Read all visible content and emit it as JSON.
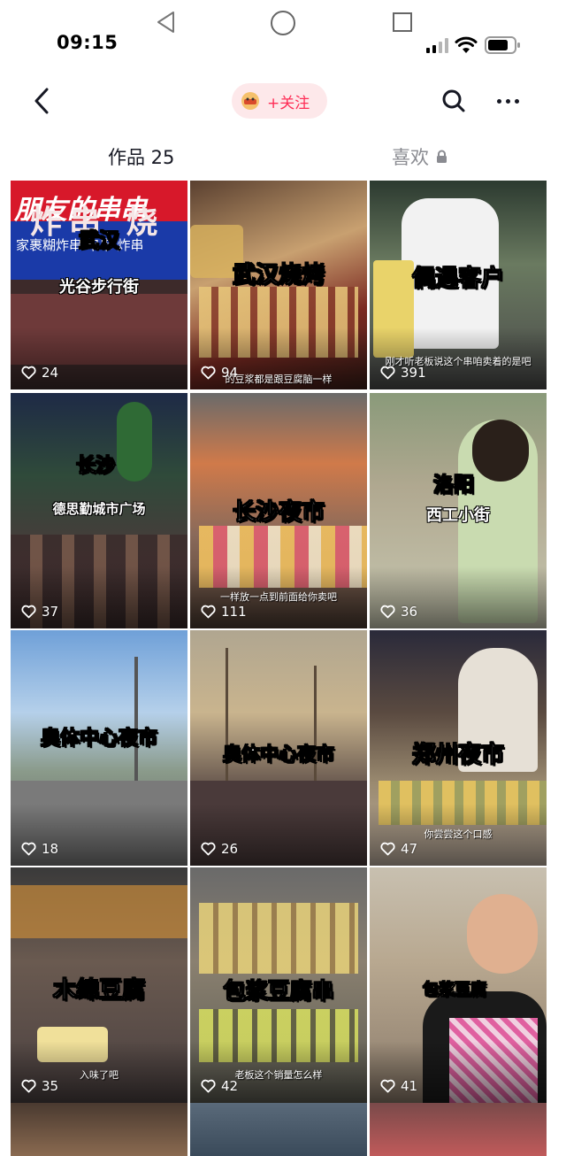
{
  "status": {
    "time": "09:15"
  },
  "nav": {
    "follow_label": "+关注"
  },
  "tabs": {
    "works": "作品 25",
    "likes": "喜欢"
  },
  "videos": [
    {
      "title": "武汉",
      "subtitle": "光谷步行街",
      "likes": "24",
      "sign_top": "朋友的串串",
      "sign_row": "家裹糊炸串 串串 炸串",
      "sign_bottom": "炸串 烧"
    },
    {
      "title": "武汉烧烤",
      "caption": "的豆浆都是跟豆腐脑一样",
      "likes": "94"
    },
    {
      "title": "偶遇客户",
      "caption": "刚才听老板说这个串咱卖着的是吧",
      "likes": "391"
    },
    {
      "title": "长沙",
      "subtitle": "德思勤城市广场",
      "likes": "37"
    },
    {
      "title": "长沙夜市",
      "caption": "一样放一点到前面给你卖吧",
      "likes": "111"
    },
    {
      "title": "洛阳",
      "subtitle": "西工小街",
      "likes": "36"
    },
    {
      "title": "奥体中心夜市",
      "likes": "18"
    },
    {
      "title": "奥体中心夜市",
      "likes": "26"
    },
    {
      "title": "郑州夜市",
      "caption": "你尝尝这个口感",
      "likes": "47"
    },
    {
      "title": "木绵豆腐",
      "caption": "入味了吧",
      "likes": "35"
    },
    {
      "title": "包浆豆腐串",
      "caption": "老板这个销量怎么样",
      "likes": "42"
    },
    {
      "title": "包浆豆腐",
      "likes": "41"
    }
  ],
  "colors": {
    "accent": "#fe2c55",
    "follow_bg": "#fde8ea",
    "text": "#161823",
    "muted": "#8a8b91"
  },
  "icons": [
    "back-icon",
    "search-icon",
    "more-icon",
    "lock-icon",
    "heart-icon",
    "avatar-icon"
  ]
}
